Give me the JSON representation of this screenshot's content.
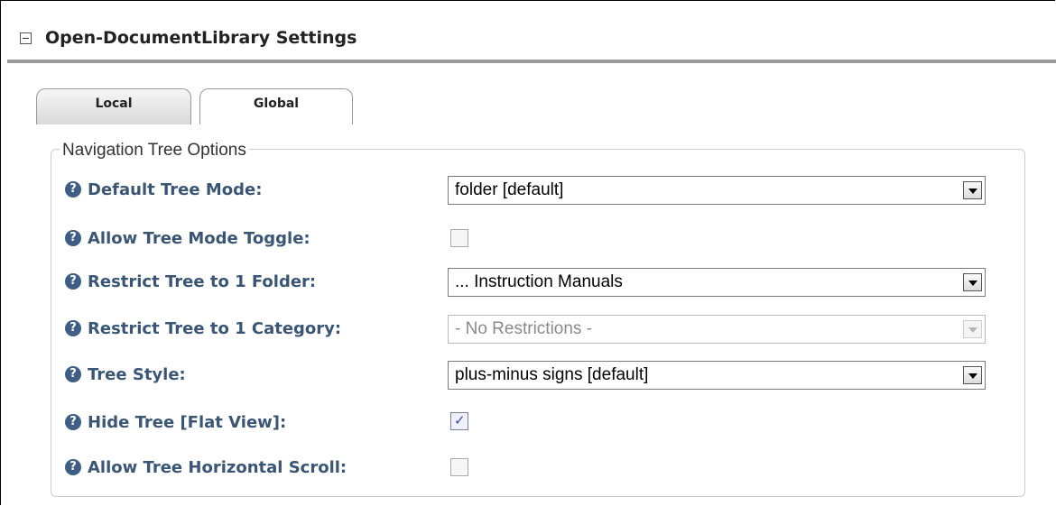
{
  "header": {
    "collapse_icon": "collapse-minus-icon",
    "title": "Open-DocumentLibrary Settings"
  },
  "tabs": [
    {
      "label": "Local",
      "active": true
    },
    {
      "label": "Global",
      "active": false
    }
  ],
  "fieldset": {
    "legend": "Navigation Tree Options",
    "help_icon": "help-question-icon",
    "rows": [
      {
        "label": "Default Tree Mode:",
        "type": "select",
        "value": "folder [default]",
        "enabled": true
      },
      {
        "label": "Allow Tree Mode Toggle:",
        "type": "checkbox",
        "checked": false
      },
      {
        "label": "Restrict Tree to 1 Folder:",
        "type": "select",
        "value": "... Instruction Manuals",
        "enabled": true
      },
      {
        "label": "Restrict Tree to 1 Category:",
        "type": "select",
        "value": "- No Restrictions -",
        "enabled": false
      },
      {
        "label": "Tree Style:",
        "type": "select",
        "value": "plus-minus signs [default]",
        "enabled": true
      },
      {
        "label": "Hide Tree [Flat View]:",
        "type": "checkbox",
        "checked": true
      },
      {
        "label": "Allow Tree Horizontal Scroll:",
        "type": "checkbox",
        "checked": false
      }
    ]
  },
  "colors": {
    "label": "#3a5674",
    "help_icon": "#3f5e83",
    "header_rule": "#9a9a9a"
  }
}
